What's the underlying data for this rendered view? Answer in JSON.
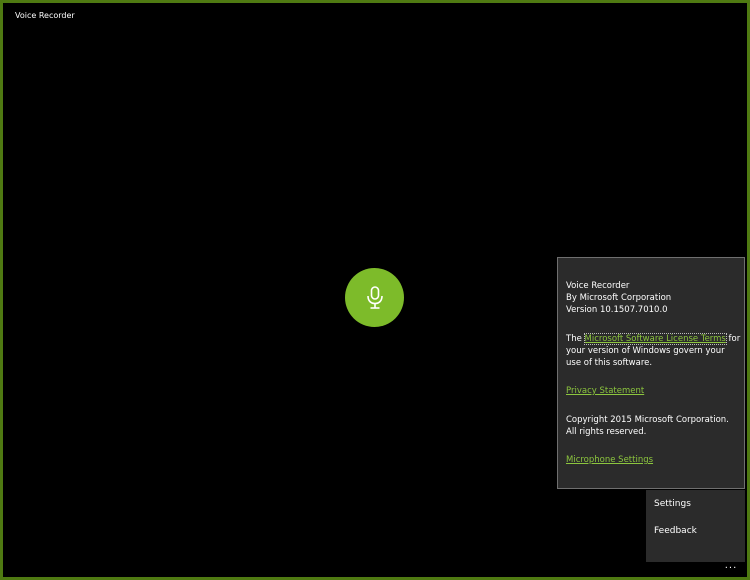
{
  "window": {
    "title": "Voice Recorder",
    "accent_color": "#4f7a12"
  },
  "record_button": {
    "color": "#7dbb2a",
    "icon": "microphone-icon"
  },
  "about": {
    "app_name": "Voice Recorder",
    "publisher": "By Microsoft Corporation",
    "version": "Version 10.1507.7010.0",
    "license_prefix": "The ",
    "license_link": "Microsoft Software License Terms",
    "license_suffix": " for your version of Windows govern your use of this software.",
    "privacy_link": "Privacy Statement",
    "copyright": "Copyright 2015 Microsoft Corporation. All rights reserved.",
    "microphone_link": "Microphone Settings",
    "link_color": "#8cc63e"
  },
  "menu": {
    "settings": "Settings",
    "feedback": "Feedback"
  },
  "more_button": {
    "label": "..."
  }
}
